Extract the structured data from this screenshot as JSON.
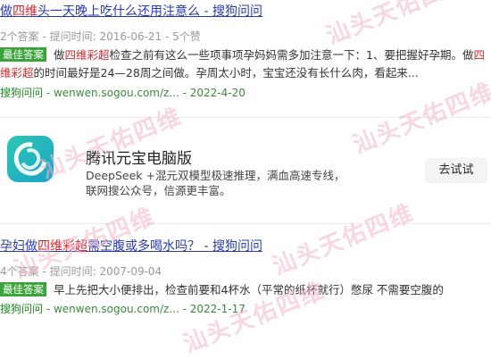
{
  "results": [
    {
      "title_parts": [
        "做",
        "四维",
        "头一天晚上吃什么还用注意么 - 搜狗问问"
      ],
      "meta": "2个答案 - 提问时间: 2016-06-21 - 5个赞",
      "snippet_parts": [
        "做",
        "四维彩超",
        "检查之前有这么一些项事项孕妈妈需多加注意一下：1、要把握好孕期。做",
        "四维彩超",
        "的时间最好是24—28周之间做。孕周太小时，宝宝还没有长什么肉，看起来..."
      ],
      "source_site": "搜狗问问",
      "source_rest": " - wenwen.sogou.com/z... - 2022-4-20",
      "badge": "最佳答案"
    },
    {
      "title_parts": [
        "孕妇做",
        "四维彩超",
        "需空腹或多喝水吗？ - 搜狗问问"
      ],
      "meta": "4个答案 - 提问时间: 2007-09-04",
      "snippet": "早上先把大小便排出，检查前要和4杯水（平常的纸杯就行）憋尿 不需要空腹的",
      "source_site": "搜狗问问",
      "source_rest": " - wenwen.sogou.com/z... - 2022-1-17",
      "badge": "最佳答案"
    }
  ],
  "ad": {
    "logo_icon": "yuanbao-app-icon",
    "title": "腾讯元宝电脑版",
    "description": "DeepSeek +混元双模型极速推理，满血高速专线，联网搜公众号，信源更丰富。",
    "button": "去试试"
  },
  "watermark": "汕头天佑四维",
  "colors": {
    "link": "#2a3ab0",
    "highlight": "#d4272b",
    "badge": "#3aa33a",
    "source": "#1b8a1b"
  }
}
